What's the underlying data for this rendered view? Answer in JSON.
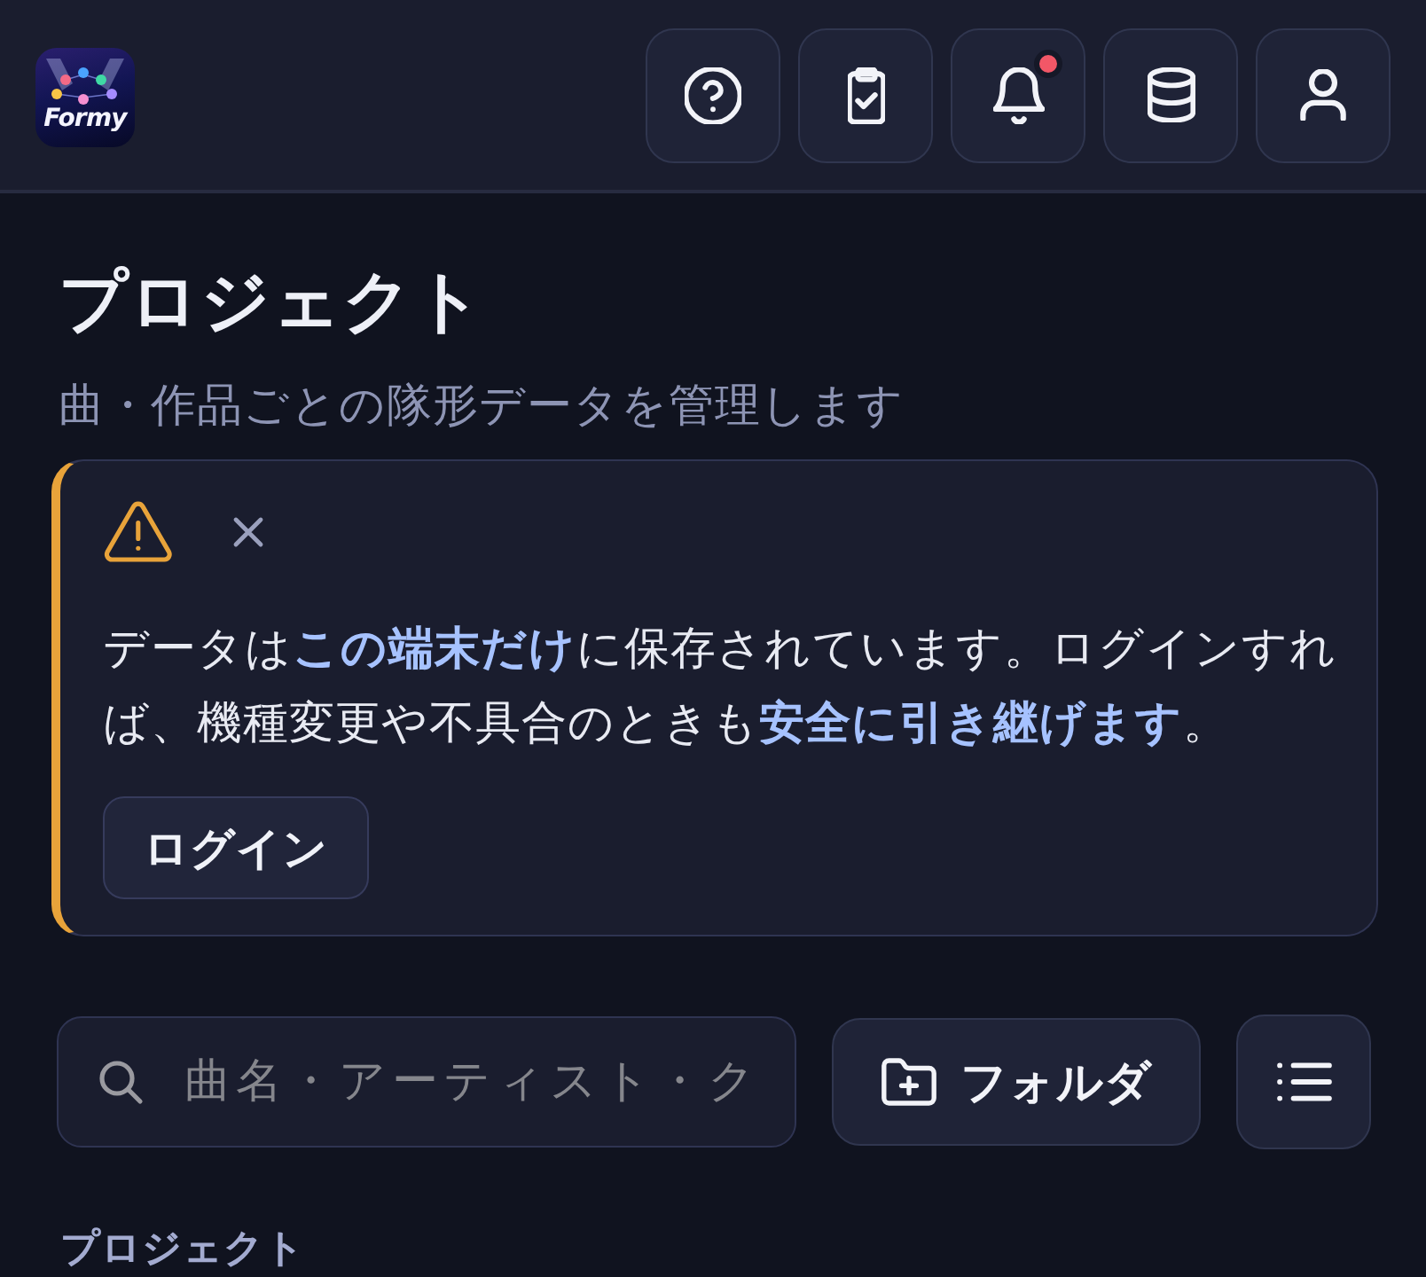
{
  "header": {
    "logo": {
      "text": "Formy"
    },
    "buttons": [
      {
        "unread": false
      },
      {
        "unread": false
      },
      {
        "unread": true
      },
      {
        "unread": false
      },
      {
        "unread": false
      }
    ]
  },
  "page": {
    "title": "プロジェクト",
    "subtitle": "曲・作品ごとの隊形データを管理します"
  },
  "notice": {
    "kind": "warning",
    "message": "データは**この端末だけ**に保存されています。ログインすれば、機種変更や不具合のときも**安全に引き継げます**。",
    "button": "ログイン"
  },
  "toolbar": {
    "search": {
      "placeholder": "曲名・アーティスト・ク"
    },
    "folder_button": {
      "label": "フォルダ"
    }
  },
  "section": {
    "heading": "プロジェクト"
  }
}
